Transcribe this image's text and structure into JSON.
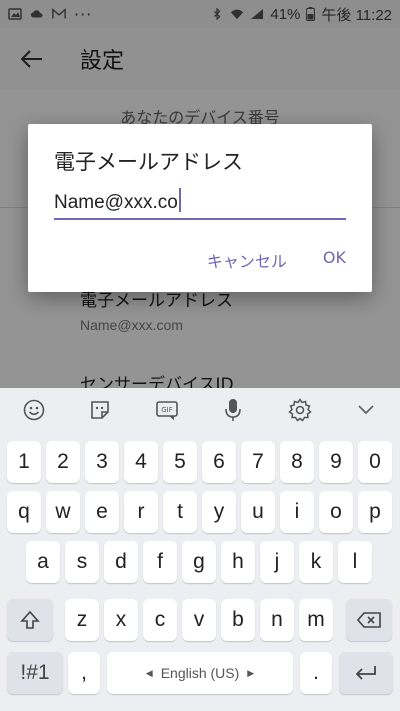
{
  "status_bar": {
    "battery": "41%",
    "time": "午後 11:22",
    "icons": [
      "image-icon",
      "cloud-icon",
      "gmail-icon",
      "more-icon",
      "bluetooth-icon",
      "wifi-icon",
      "signal-icon",
      "battery-icon"
    ]
  },
  "appbar": {
    "title": "設定"
  },
  "settings": {
    "section_title": "あなたのデバイス番号",
    "email_label": "電子メールアドレス",
    "email_value": "Name@xxx.com",
    "sensor_label": "センサーデバイスID"
  },
  "dialog": {
    "title": "電子メールアドレス",
    "input_value": "Name@xxx.co",
    "cancel": "キャンセル",
    "ok": "OK"
  },
  "keyboard": {
    "toolbar": [
      "emoji-icon",
      "sticker-icon",
      "gif-icon",
      "mic-icon",
      "settings-icon",
      "collapse-icon"
    ],
    "gif_label": "GIF",
    "row1": [
      "1",
      "2",
      "3",
      "4",
      "5",
      "6",
      "7",
      "8",
      "9",
      "0"
    ],
    "row2": [
      "q",
      "w",
      "e",
      "r",
      "t",
      "y",
      "u",
      "i",
      "o",
      "p"
    ],
    "row3": [
      "a",
      "s",
      "d",
      "f",
      "g",
      "h",
      "j",
      "k",
      "l"
    ],
    "row4": [
      "z",
      "x",
      "c",
      "v",
      "b",
      "n",
      "m"
    ],
    "symbols_key": "!#1",
    "comma_key": ",",
    "space_label": "English (US)",
    "period_key": ".",
    "accent_color": "#6e67b2"
  }
}
